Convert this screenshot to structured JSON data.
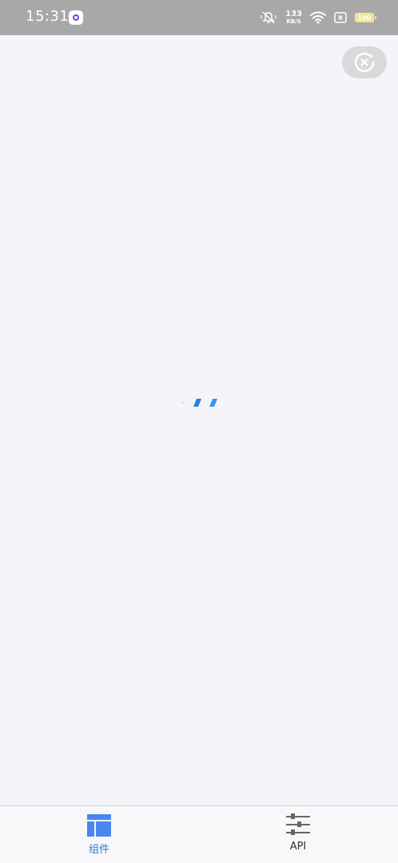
{
  "status_bar": {
    "time": "15:31",
    "net_speed_value": "133",
    "net_speed_unit": "KB/S",
    "battery_level": "100",
    "icons": [
      "app-notification-icon",
      "mute-icon",
      "wifi-icon",
      "no-sim-icon",
      "battery-icon"
    ]
  },
  "header": {
    "capsule_icon": "close-circle-icon"
  },
  "main": {
    "loading_icon": "loading-icon"
  },
  "tab_bar": {
    "tabs": [
      {
        "label": "组件",
        "icon": "layout-icon",
        "active": true
      },
      {
        "label": "API",
        "icon": "sliders-icon",
        "active": false
      }
    ]
  },
  "colors": {
    "status_bar_bg": "#a8a8a8",
    "page_bg": "#f4f4f9",
    "accent": "#2a7de1",
    "tab_icon_active": "#4a86f0",
    "tab_icon_inactive": "#666666"
  }
}
